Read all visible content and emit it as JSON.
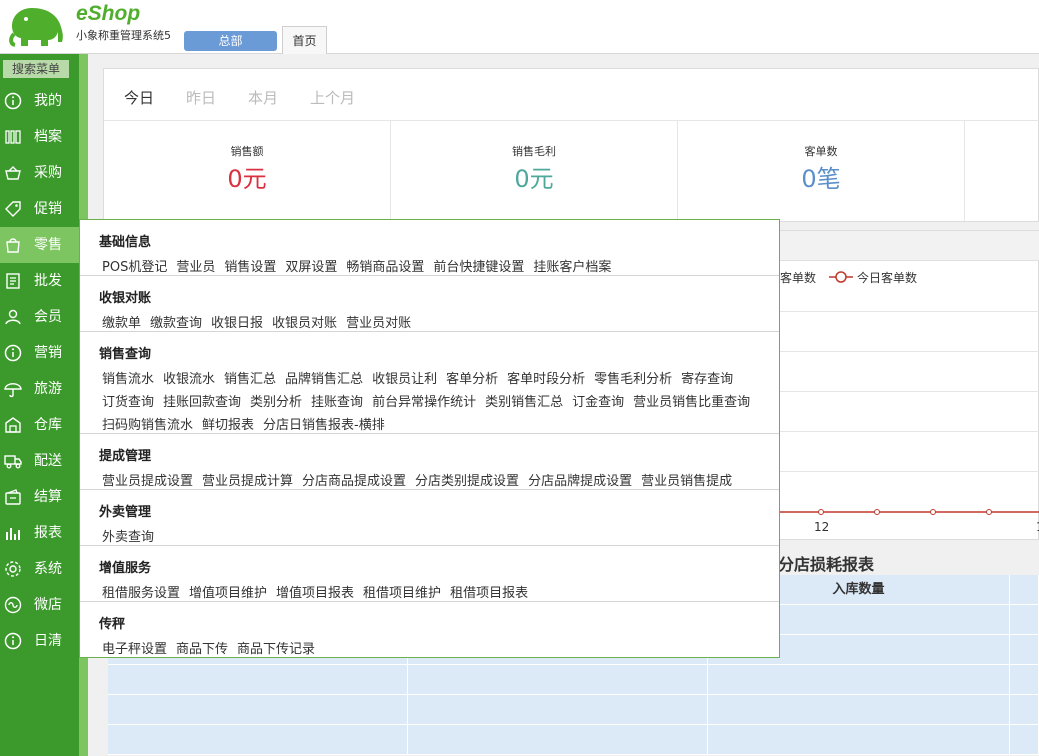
{
  "header": {
    "brand": "eShop",
    "system_name": "小象称重管理系统5",
    "branch_button": "总部",
    "tabs": [
      {
        "label": "首页"
      }
    ]
  },
  "sidebar": {
    "search_label": "搜索菜单",
    "items": [
      {
        "label": "我的",
        "icon": "info-icon"
      },
      {
        "label": "档案",
        "icon": "archive-icon"
      },
      {
        "label": "采购",
        "icon": "basket-icon"
      },
      {
        "label": "促销",
        "icon": "tag-icon"
      },
      {
        "label": "零售",
        "icon": "bag-icon",
        "active": true
      },
      {
        "label": "批发",
        "icon": "receipt-icon"
      },
      {
        "label": "会员",
        "icon": "user-icon"
      },
      {
        "label": "营销",
        "icon": "info-icon"
      },
      {
        "label": "旅游",
        "icon": "umbrella-icon"
      },
      {
        "label": "仓库",
        "icon": "warehouse-icon"
      },
      {
        "label": "配送",
        "icon": "truck-icon"
      },
      {
        "label": "结算",
        "icon": "wallet-icon"
      },
      {
        "label": "报表",
        "icon": "bar-chart-icon"
      },
      {
        "label": "系统",
        "icon": "gear-icon"
      },
      {
        "label": "微店",
        "icon": "store-icon"
      },
      {
        "label": "日清",
        "icon": "info-icon"
      }
    ]
  },
  "dashboard": {
    "date_tabs": [
      "今日",
      "昨日",
      "本月",
      "上个月"
    ],
    "active_tab": "今日",
    "stats": [
      {
        "title": "销售额",
        "value": "0元",
        "color": "#d9313f"
      },
      {
        "title": "销售毛利",
        "value": "0元",
        "color": "#4fa89a"
      },
      {
        "title": "客单数",
        "value": "0笔",
        "color": "#5b8fc9"
      }
    ],
    "legend": [
      "客单数",
      "今日客单数"
    ],
    "x_ticks": [
      "12",
      "1"
    ],
    "report_title": "分店损耗报表",
    "report_columns": [
      "入库数量"
    ]
  },
  "menu": {
    "sections": [
      {
        "title": "基础信息",
        "lines": [
          [
            "POS机登记",
            "营业员",
            "销售设置",
            "双屏设置",
            "畅销商品设置",
            "前台快捷键设置",
            "挂账客户档案"
          ]
        ]
      },
      {
        "title": "收银对账",
        "lines": [
          [
            "缴款单",
            "缴款查询",
            "收银日报",
            "收银员对账",
            "营业员对账"
          ]
        ]
      },
      {
        "title": "销售查询",
        "lines": [
          [
            "销售流水",
            "收银流水",
            "销售汇总",
            "品牌销售汇总",
            "收银员让利",
            "客单分析",
            "客单时段分析",
            "零售毛利分析",
            "寄存查询"
          ],
          [
            "订货查询",
            "挂账回款查询",
            "类别分析",
            "挂账查询",
            "前台异常操作统计",
            "类别销售汇总",
            "订金查询",
            "营业员销售比重查询"
          ],
          [
            "扫码购销售流水",
            "鲜切报表",
            "分店日销售报表-横排"
          ]
        ]
      },
      {
        "title": "提成管理",
        "lines": [
          [
            "营业员提成设置",
            "营业员提成计算",
            "分店商品提成设置",
            "分店类别提成设置",
            "分店品牌提成设置",
            "营业员销售提成"
          ]
        ]
      },
      {
        "title": "外卖管理",
        "lines": [
          [
            "外卖查询"
          ]
        ]
      },
      {
        "title": "增值服务",
        "lines": [
          [
            "租借服务设置",
            "增值项目维护",
            "增值项目报表",
            "租借项目维护",
            "租借项目报表"
          ]
        ]
      },
      {
        "title": "传秤",
        "lines": [
          [
            "电子秤设置",
            "商品下传",
            "商品下传记录"
          ]
        ]
      }
    ]
  }
}
